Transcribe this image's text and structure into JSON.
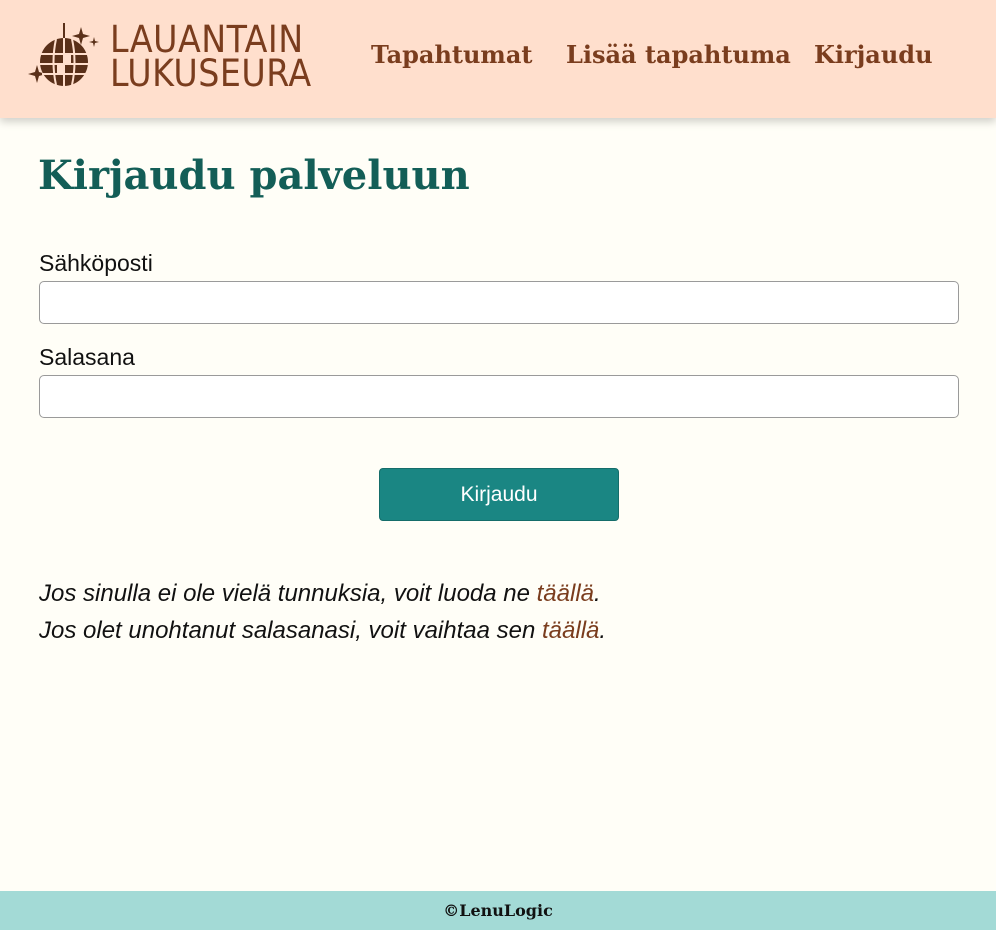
{
  "brand": {
    "line1": "Lauantain",
    "line2": "Lukuseura"
  },
  "nav": {
    "items": [
      {
        "label": "Tapahtumat"
      },
      {
        "label": "Lisää tapahtuma"
      },
      {
        "label": "Kirjaudu"
      }
    ]
  },
  "login": {
    "title": "Kirjaudu palveluun",
    "email_label": "Sähköposti",
    "email_value": "",
    "password_label": "Salasana",
    "password_value": "",
    "submit_label": "Kirjaudu",
    "signup_text": "Jos sinulla ei ole vielä tunnuksia, voit luoda ne ",
    "signup_link": "täällä",
    "reset_text": "Jos olet unohtanut salasanasi, voit vaihtaa sen ",
    "reset_link": "täällä",
    "period": "."
  },
  "footer": {
    "text": "©LenuLogic"
  },
  "colors": {
    "header_bg": "#ffdfcd",
    "page_bg": "#fffef7",
    "brand_brown": "#7a3d1e",
    "title_teal": "#135e57",
    "button_teal": "#1a8683",
    "footer_bg": "#a3dad6"
  },
  "icons": {
    "logo": "disco-ball-icon"
  }
}
